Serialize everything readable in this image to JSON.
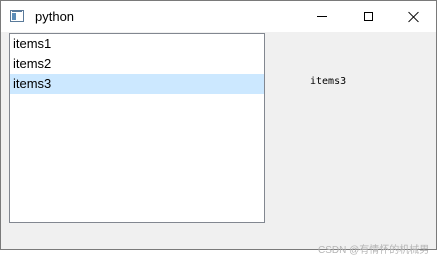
{
  "window": {
    "title": "python",
    "controls": {
      "minimize_icon": "minimize-icon",
      "maximize_icon": "maximize-icon",
      "close_icon": "close-icon"
    }
  },
  "list": {
    "items": [
      {
        "label": "items1",
        "selected": false
      },
      {
        "label": "items2",
        "selected": false
      },
      {
        "label": "items3",
        "selected": true
      }
    ]
  },
  "label": {
    "text": "items3"
  },
  "watermark": "CSDN @有情怀的机械男",
  "colors": {
    "selection": "#cce8ff",
    "window_bg": "#f0f0f0",
    "border": "#828790"
  }
}
